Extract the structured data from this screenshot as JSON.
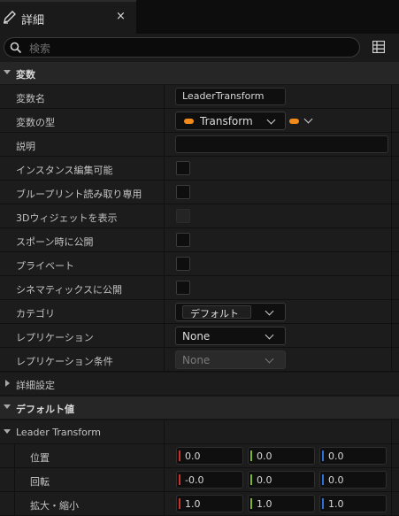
{
  "tab": {
    "title": "詳細",
    "close": "×"
  },
  "search": {
    "placeholder": "検索",
    "value": ""
  },
  "sections": {
    "variable": "変数",
    "advanced": "詳細設定",
    "default": "デフォルト値"
  },
  "props": {
    "var_name": {
      "label": "変数名",
      "value": "LeaderTransform"
    },
    "var_type": {
      "label": "変数の型",
      "value": "Transform"
    },
    "description": {
      "label": "説明",
      "value": ""
    },
    "instance_editable": {
      "label": "インスタンス編集可能"
    },
    "bp_readonly": {
      "label": "ブループリント読み取り専用"
    },
    "show_3d_widget": {
      "label": "3Dウィジェットを表示"
    },
    "expose_on_spawn": {
      "label": "スポーン時に公開"
    },
    "private": {
      "label": "プライベート"
    },
    "expose_cinematics": {
      "label": "シネマティックスに公開"
    },
    "category": {
      "label": "カテゴリ",
      "value": "デフォルト"
    },
    "replication": {
      "label": "レプリケーション",
      "value": "None"
    },
    "replication_condition": {
      "label": "レプリケーション条件",
      "value": "None"
    }
  },
  "default_value": {
    "struct_label": "Leader Transform",
    "location": {
      "label": "位置",
      "x": "0.0",
      "y": "0.0",
      "z": "0.0"
    },
    "rotation": {
      "label": "回転",
      "x": "-0.0",
      "y": "0.0",
      "z": "0.0"
    },
    "scale": {
      "label": "拡大・縮小",
      "x": "1.0",
      "y": "1.0",
      "z": "1.0"
    }
  },
  "colors": {
    "type_pill": "#f28b1c",
    "axis_x": "#c8322c",
    "axis_y": "#7ab82a",
    "axis_z": "#2f6fd6"
  },
  "icons": {
    "tab": "pencil-icon",
    "search": "search-icon",
    "grid": "grid-icon"
  }
}
